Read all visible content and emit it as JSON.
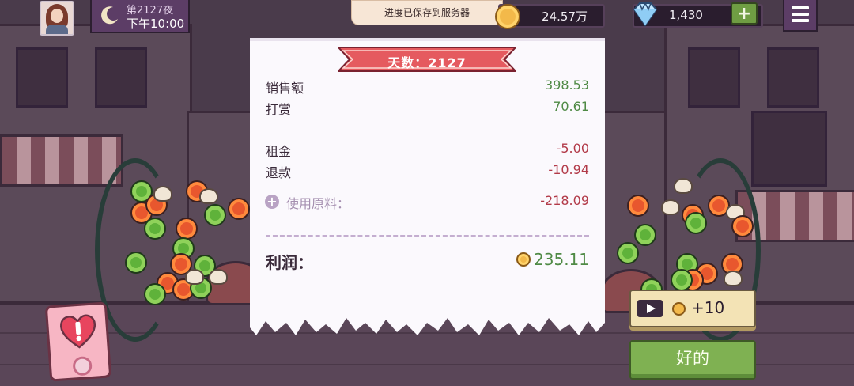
{
  "hud": {
    "night_title": "第2127夜",
    "time": "下午10:00",
    "toast": "进度已保存到服务器",
    "coins": "24.57万",
    "gems": "1,430",
    "add_label": "+"
  },
  "receipt": {
    "day_label": "天数：2127",
    "rows": [
      {
        "label": "销售额",
        "value": "398.53"
      },
      {
        "label": "打赏",
        "value": "70.61"
      },
      {
        "label": "租金",
        "value": "-5.00"
      },
      {
        "label": "退款",
        "value": "-10.94"
      }
    ],
    "materials": {
      "icon": "+",
      "label": "使用原料：",
      "value": "-218.09"
    },
    "profit": {
      "label": "利润：",
      "value": "235.11"
    }
  },
  "actions": {
    "ad_reward": "+10",
    "ok": "好的"
  },
  "colors": {
    "positive": "#4f8a45",
    "negative": "#b23a48",
    "ok_button": "#7fb152",
    "ribbon": "#e55a5f"
  }
}
